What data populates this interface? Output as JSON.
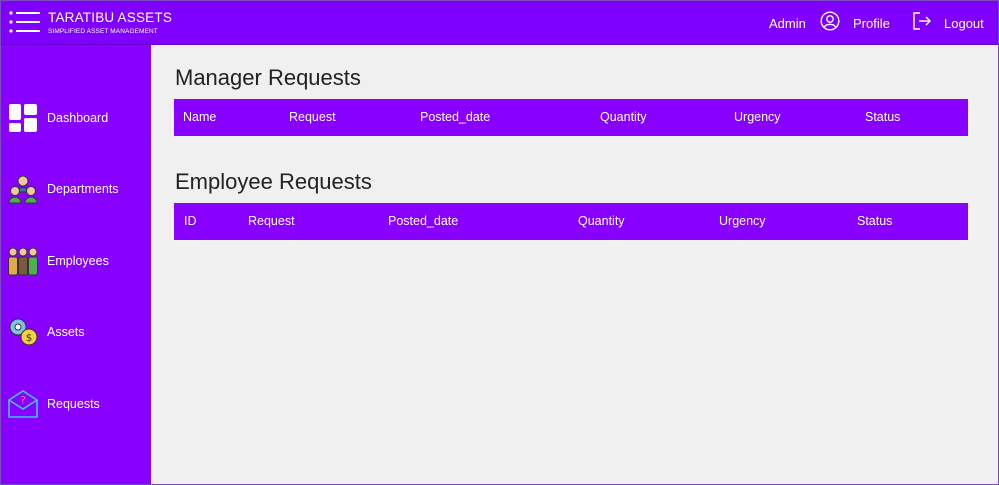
{
  "header": {
    "brand_title": "TARATIBU ASSETS",
    "brand_subtitle": "SIMPLIFIED ASSET MANAGEMENT",
    "user_name": "Admin",
    "profile_label": "Profile",
    "logout_label": "Logout",
    "accent_color": "#7f00ff"
  },
  "sidebar": {
    "background_color": "#8800ff",
    "items": [
      {
        "label": "Dashboard",
        "icon": "dashboard-icon"
      },
      {
        "label": "Departments",
        "icon": "departments-icon"
      },
      {
        "label": "Employees",
        "icon": "employees-icon"
      },
      {
        "label": "Assets",
        "icon": "assets-icon"
      },
      {
        "label": "Requests",
        "icon": "requests-icon"
      }
    ]
  },
  "manager_requests": {
    "title": "Manager Requests",
    "columns": [
      "Name",
      "Request",
      "Posted_date",
      "Quantity",
      "Urgency",
      "Status"
    ],
    "rows": []
  },
  "employee_requests": {
    "title": "Employee Requests",
    "columns": [
      "ID",
      "Request",
      "Posted_date",
      "Quantity",
      "Urgency",
      "Status"
    ],
    "rows": []
  }
}
